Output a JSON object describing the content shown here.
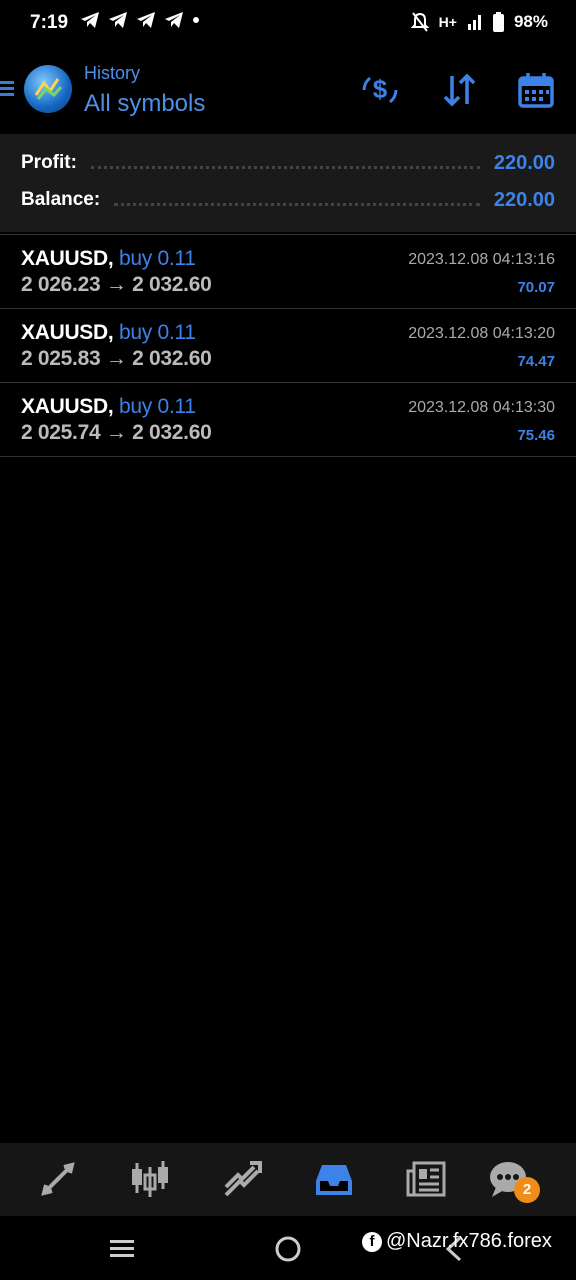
{
  "status_bar": {
    "time": "7:19",
    "network": "H+",
    "battery": "98%"
  },
  "header": {
    "subtitle": "History",
    "title": "All symbols"
  },
  "summary": {
    "profit_label": "Profit:",
    "profit_value": "220.00",
    "balance_label": "Balance:",
    "balance_value": "220.00"
  },
  "trades": [
    {
      "symbol": "XAUUSD,",
      "side": "buy 0.11",
      "prices": "2 026.23 → 2 032.60",
      "time": "2023.12.08 04:13:16",
      "profit": "70.07"
    },
    {
      "symbol": "XAUUSD,",
      "side": "buy 0.11",
      "prices": "2 025.83 → 2 032.60",
      "time": "2023.12.08 04:13:20",
      "profit": "74.47"
    },
    {
      "symbol": "XAUUSD,",
      "side": "buy 0.11",
      "prices": "2 025.74 → 2 032.60",
      "time": "2023.12.08 04:13:30",
      "profit": "75.46"
    }
  ],
  "bottom_nav": {
    "items": [
      "quotes-icon",
      "chart-icon",
      "trade-icon",
      "history-icon",
      "news-icon",
      "messages-icon"
    ],
    "active": "history-icon",
    "messages_badge": "2"
  },
  "watermark": "@Nazr.fx786.forex",
  "colors": {
    "accent": "#3d82e6",
    "badge": "#f08c1a",
    "background": "#000000",
    "panel": "#1a1a1a"
  }
}
